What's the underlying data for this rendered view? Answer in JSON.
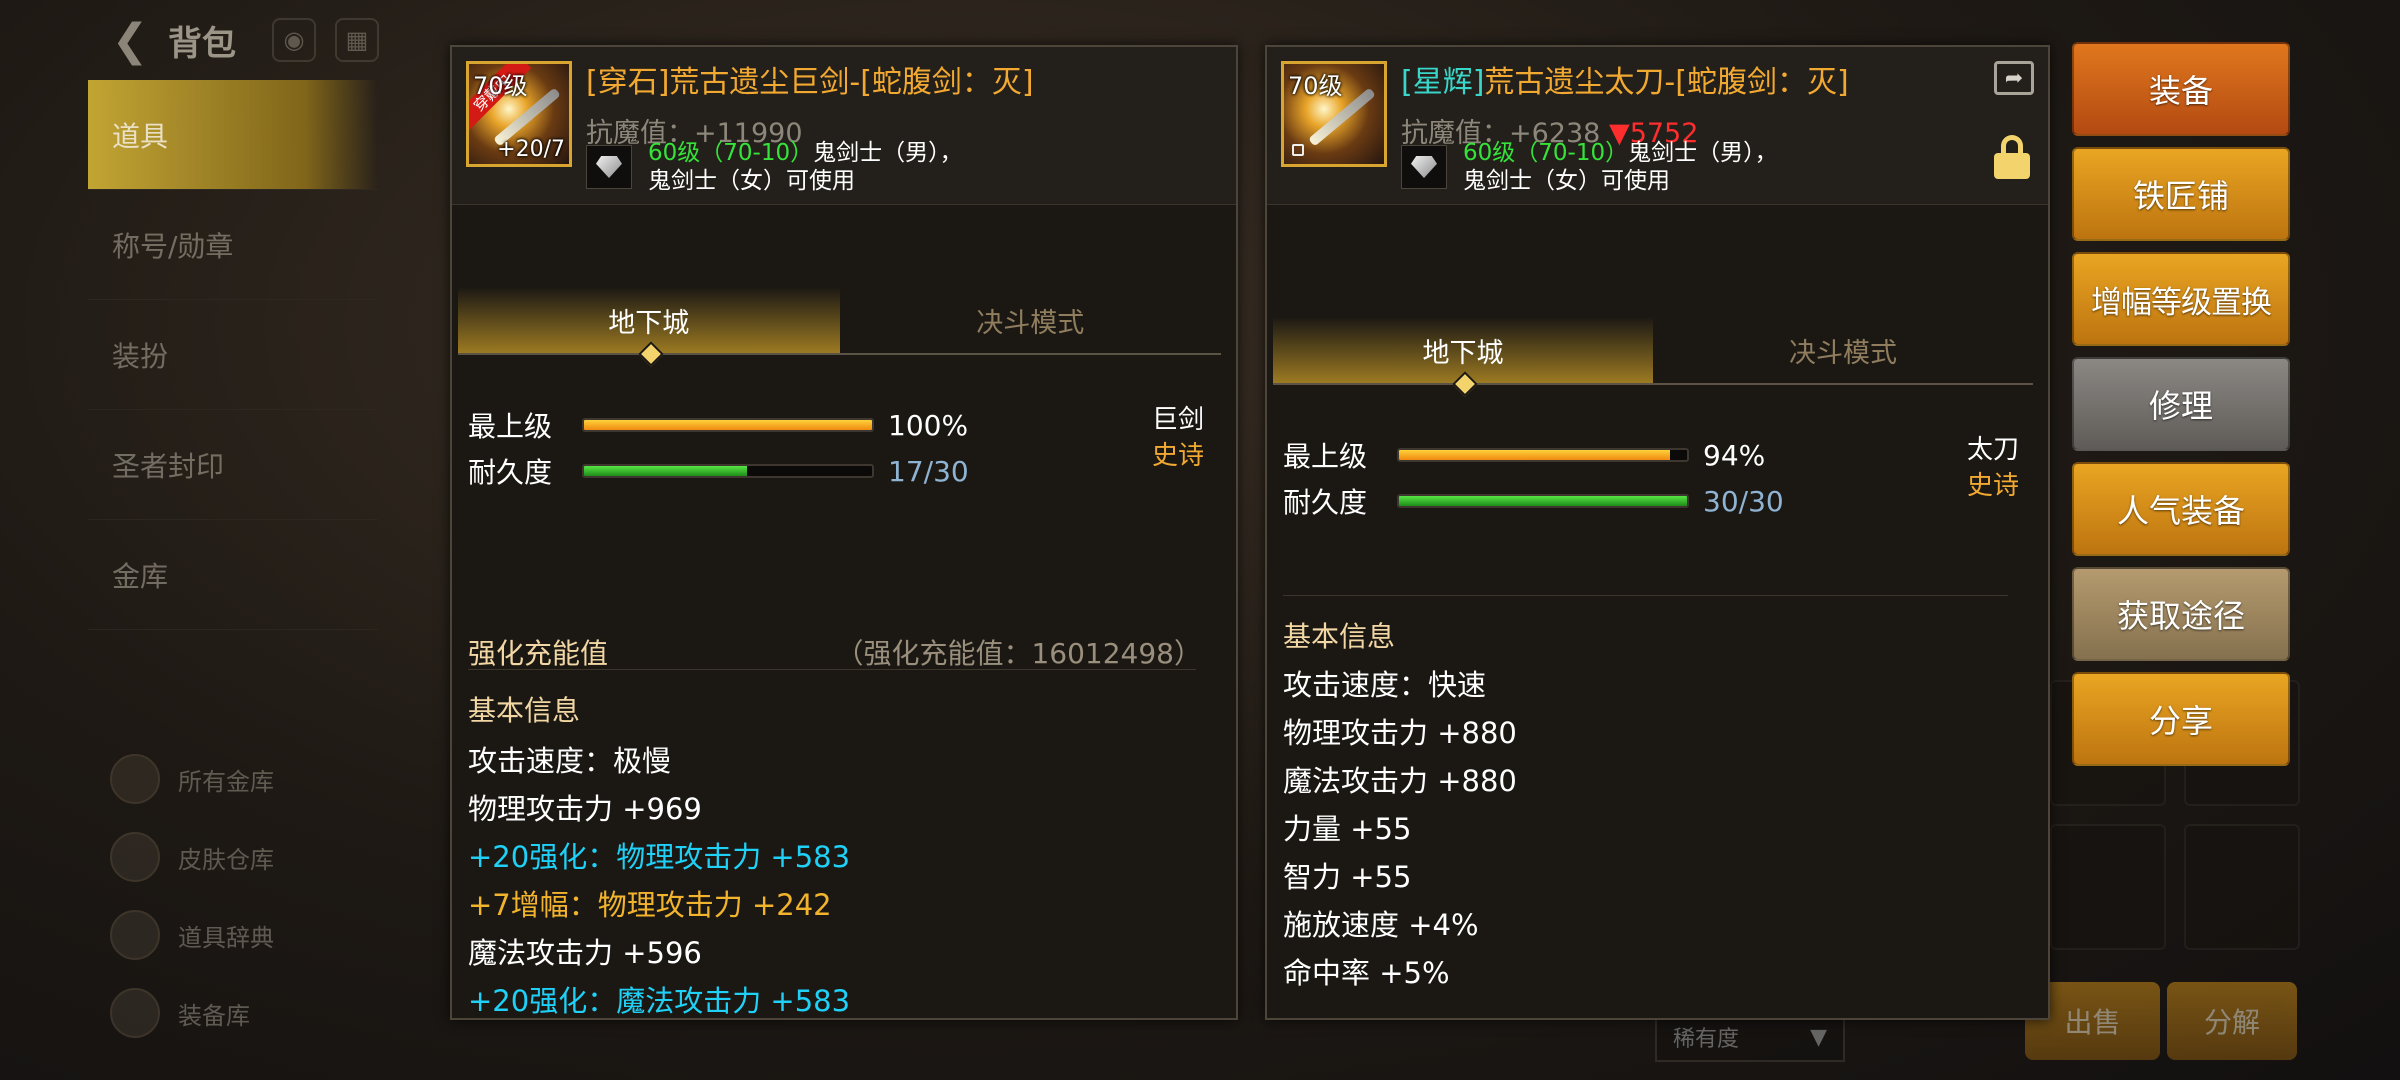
{
  "background": {
    "bag_title": "背包",
    "menu_items": [
      "道具",
      "称号/勋章",
      "装扮",
      "圣者封印",
      "金库"
    ],
    "sub_items": [
      "所有金库",
      "皮肤仓库",
      "道具辞典",
      "装备库"
    ],
    "rarity_filter": "稀有度",
    "sell_label": "出售",
    "decompose_label": "分解"
  },
  "left_panel": {
    "level_tag": "70级",
    "equipped_tag": "穿戴中",
    "enhance_tag": "+20/7",
    "name": "[穿石]荒古遗尘巨剑-[蛇腹剑：灭]",
    "resist": "抗魔值：+11990",
    "req_level": "60级（70-10）",
    "req_class_1": "鬼剑士（男），",
    "req_class_2": "鬼剑士（女）可使用",
    "tabs": [
      "地下城",
      "决斗模式"
    ],
    "stats": {
      "top_label": "最上级",
      "top_value": "100%",
      "top_fraction": 1.0,
      "durability_label": "耐久度",
      "durability_value": "17/30",
      "durability_fraction": 0.5667
    },
    "weapon_type": "巨剑",
    "rarity": "史诗",
    "charge_label": "强化充能值",
    "charge_value": "（强化充能值：16012498）",
    "info_title": "基本信息",
    "info": [
      {
        "text": "攻击速度：极慢",
        "style": ""
      },
      {
        "text": "物理攻击力 +969",
        "style": ""
      },
      {
        "text": "+20强化：物理攻击力 +583",
        "style": "cyan"
      },
      {
        "text": " +7增幅：物理攻击力 +242",
        "style": "gold"
      },
      {
        "text": "魔法攻击力 +596",
        "style": ""
      },
      {
        "text": "+20强化：魔法攻击力 +583",
        "style": "cyan"
      }
    ]
  },
  "right_panel": {
    "level_tag": "70级",
    "name_prefix": "[星辉]",
    "name": "荒古遗尘太刀-[蛇腹剑：灭]",
    "resist": "抗魔值：+6238",
    "resist_down": "▼5752",
    "req_level": "60级（70-10）",
    "req_class_1": "鬼剑士（男），",
    "req_class_2": "鬼剑士（女）可使用",
    "tabs": [
      "地下城",
      "决斗模式"
    ],
    "stats": {
      "top_label": "最上级",
      "top_value": "94%",
      "top_fraction": 0.94,
      "durability_label": "耐久度",
      "durability_value": "30/30",
      "durability_fraction": 1.0
    },
    "weapon_type": "太刀",
    "rarity": "史诗",
    "info_title": "基本信息",
    "info": [
      "攻击速度：快速",
      "物理攻击力 +880",
      "魔法攻击力 +880",
      "力量 +55",
      "智力 +55",
      "施放速度 +4%",
      "命中率 +5%"
    ]
  },
  "actions": [
    {
      "label": "装备",
      "style": "orange"
    },
    {
      "label": "铁匠铺",
      "style": "amber"
    },
    {
      "label": "增幅等级置换",
      "style": "amber"
    },
    {
      "label": "修理",
      "style": "gray"
    },
    {
      "label": "人气装备",
      "style": "amber"
    },
    {
      "label": "获取途径",
      "style": "tan"
    },
    {
      "label": "分享",
      "style": "amber"
    }
  ],
  "colors": {
    "item_name": "#f2a931",
    "enhance_cyan": "#1fd0f7",
    "amplify_gold": "#f3b42d",
    "req_green": "#35e33a",
    "resist_down_red": "#ff2e2e"
  }
}
